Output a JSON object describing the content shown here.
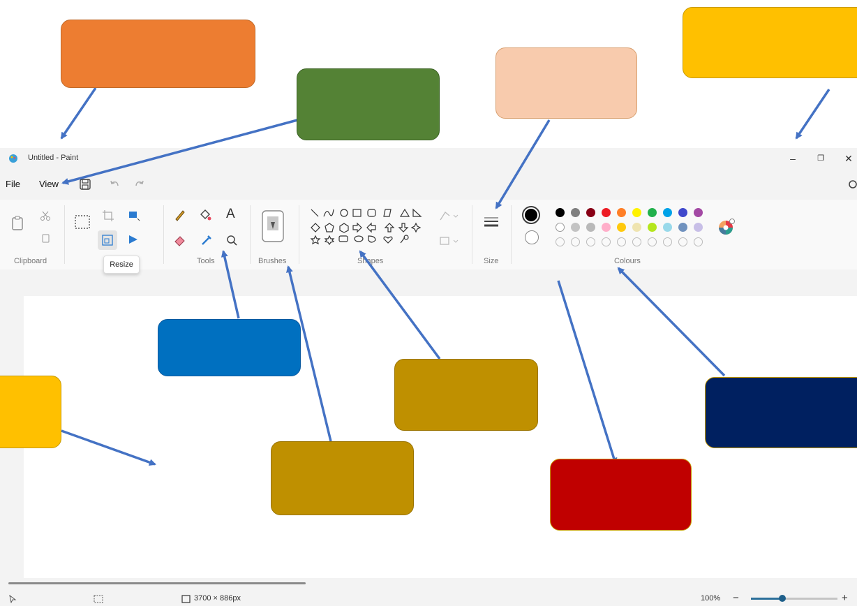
{
  "window": {
    "title": "Untitled - Paint",
    "minimize": "–",
    "maximize": "❐",
    "close": "✕"
  },
  "menu": {
    "file": "File",
    "view": "View"
  },
  "ribbon": {
    "groups": {
      "clipboard": "Clipboard",
      "tools": "Tools",
      "brushes": "Brushes",
      "shapes": "Shapes",
      "size": "Size",
      "colours": "Colours"
    },
    "tooltip": "Resize",
    "text_tool": "A"
  },
  "palette": {
    "row1": [
      "#000000",
      "#7f7f7f",
      "#880015",
      "#ed1c24",
      "#ff7f27",
      "#fff200",
      "#22b14c",
      "#00a2e8",
      "#3f48cc",
      "#a349a4"
    ],
    "row2": [
      "#ffffff",
      "#c3c3c3",
      "#b9b9b9",
      "#ffaec9",
      "#ffc90e",
      "#efe4b0",
      "#b5e61d",
      "#99d9ea",
      "#7092be",
      "#c8bfe7"
    ],
    "primary": "#000000",
    "secondary": "#ffffff"
  },
  "status": {
    "canvas_size": "3700 × 886px",
    "zoom": "100%",
    "zoom_out": "−",
    "zoom_in": "+"
  },
  "callout_colors": {
    "orange": "#ED7D31",
    "green": "#548235",
    "peach": "#F8CBAD",
    "yellow": "#FFC000",
    "blue": "#0070C0",
    "gold": "#BF9000",
    "red": "#C00000",
    "navy": "#002060",
    "arrow": "#4472C4"
  }
}
